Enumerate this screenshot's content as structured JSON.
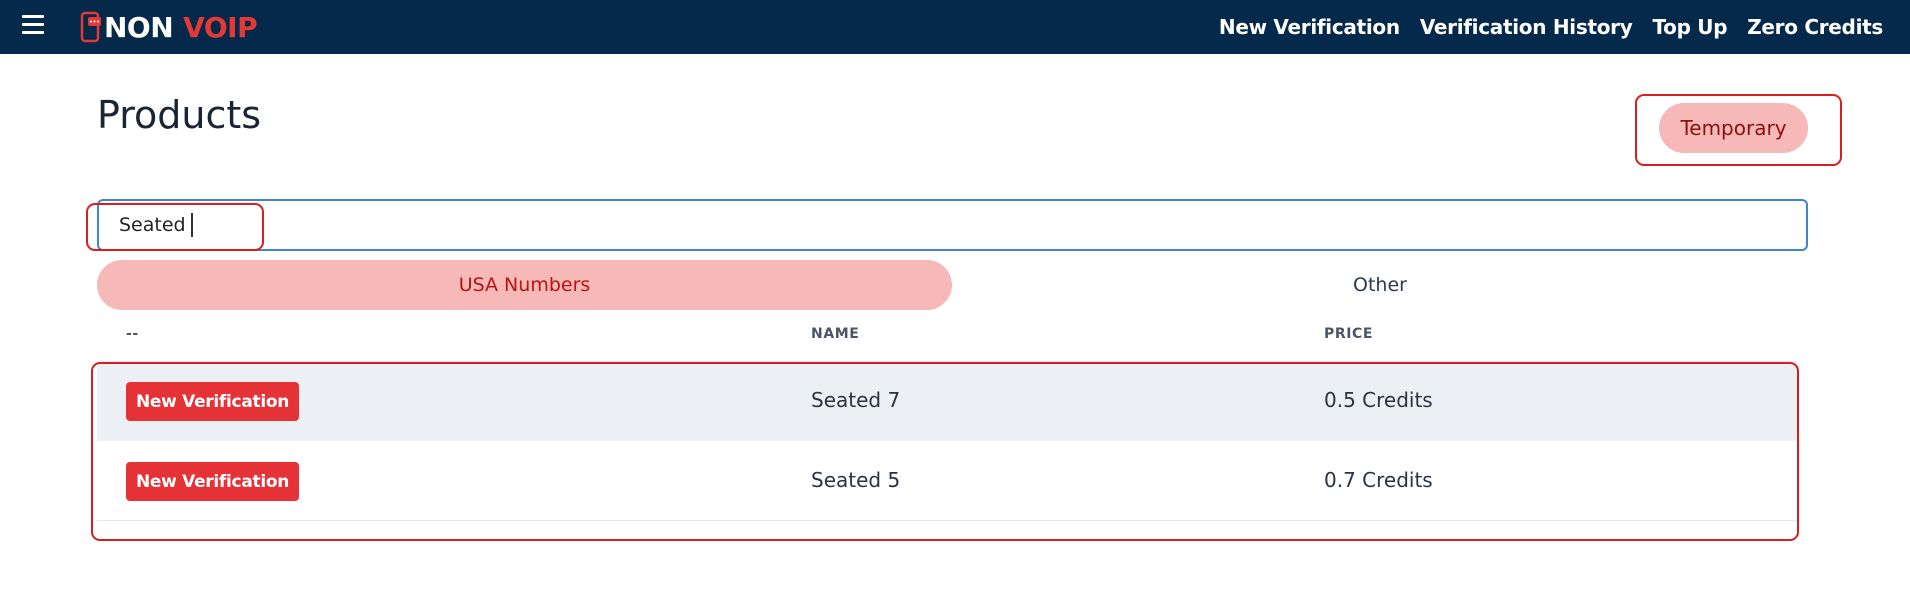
{
  "brand": {
    "name_part1": "NON",
    "name_part2": "VOIP",
    "accent": "#e53935",
    "navbar_bg": "#04294a"
  },
  "nav": {
    "menu_icon": "hamburger-icon",
    "links": [
      "New Verification",
      "Verification History",
      "Top Up",
      "Zero Credits"
    ]
  },
  "page": {
    "title": "Products"
  },
  "type_button": {
    "label": "Temporary"
  },
  "search": {
    "value": "Seated",
    "placeholder": ""
  },
  "tabs": [
    {
      "label": "USA Numbers",
      "active": true
    },
    {
      "label": "Other",
      "active": false
    }
  ],
  "table": {
    "headers": [
      "--",
      "NAME",
      "PRICE"
    ],
    "rows": [
      {
        "action": "New Verification",
        "name": "Seated 7",
        "price": "0.5 Credits"
      },
      {
        "action": "New Verification",
        "name": "Seated 5",
        "price": "0.7 Credits"
      }
    ]
  },
  "colors": {
    "pill_bg": "#f7b8b8",
    "pill_text": "#b71414",
    "action_red": "#e53236",
    "focus_blue": "#3f83d4",
    "highlight_red": "#d81e1e"
  }
}
